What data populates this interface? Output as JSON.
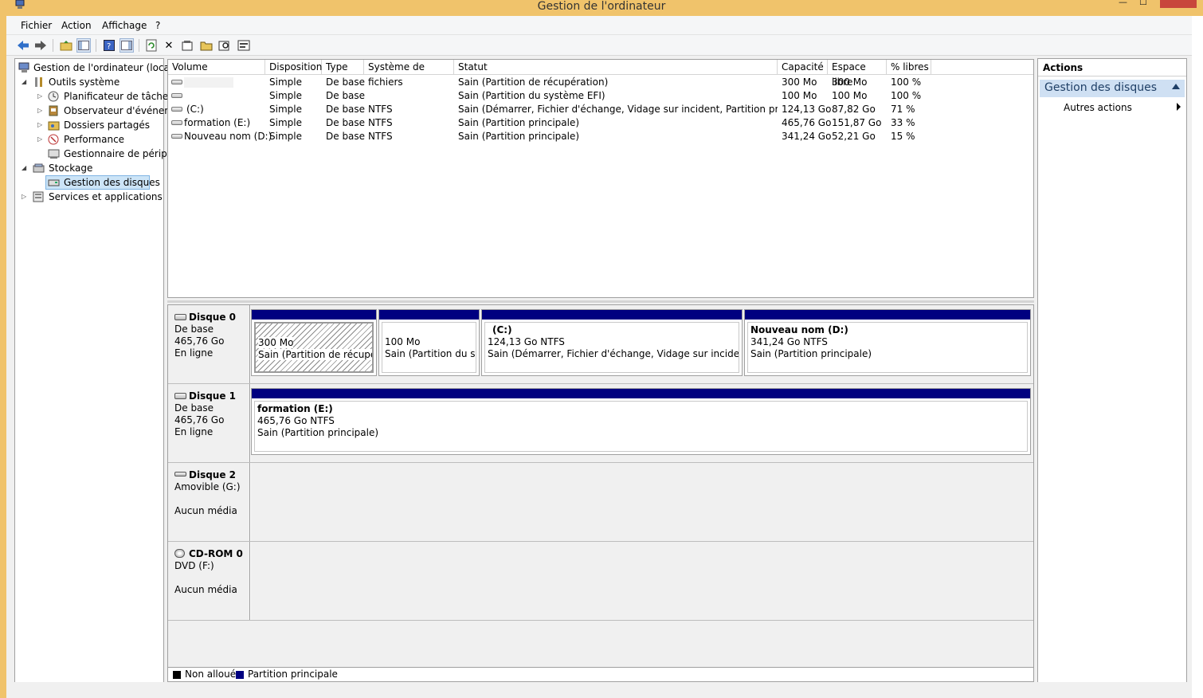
{
  "window": {
    "title": "Gestion de l'ordinateur"
  },
  "menu": [
    "Fichier",
    "Action",
    "Affichage",
    "?"
  ],
  "tree": {
    "root": "Gestion de l'ordinateur (local)",
    "outils": "Outils système",
    "planif": "Planificateur de tâches",
    "observ": "Observateur d'événeme",
    "dossiers": "Dossiers partagés",
    "perf": "Performance",
    "gestperiph": "Gestionnaire de périphé",
    "stockage": "Stockage",
    "gestdisques": "Gestion des disques",
    "services": "Services et applications"
  },
  "volumes": {
    "columns": [
      "Volume",
      "Disposition",
      "Type",
      "Système de fichiers",
      "Statut",
      "Capacité",
      "Espace libre",
      "% libres"
    ],
    "rows": [
      {
        "volume": "",
        "disposition": "Simple",
        "type": "De base",
        "fs": "",
        "statut": "Sain (Partition de récupération)",
        "capacite": "300 Mo",
        "libre": "300 Mo",
        "pct": "100 %"
      },
      {
        "volume": "",
        "disposition": "Simple",
        "type": "De base",
        "fs": "",
        "statut": "Sain (Partition du système EFI)",
        "capacite": "100 Mo",
        "libre": "100 Mo",
        "pct": "100 %"
      },
      {
        "volume": "(C:)",
        "disposition": "Simple",
        "type": "De base",
        "fs": "NTFS",
        "statut": "Sain (Démarrer, Fichier d'échange, Vidage sur incident, Partition principale)",
        "capacite": "124,13 Go",
        "libre": "87,82 Go",
        "pct": "71 %"
      },
      {
        "volume": "formation (E:)",
        "disposition": "Simple",
        "type": "De base",
        "fs": "NTFS",
        "statut": "Sain (Partition principale)",
        "capacite": "465,76 Go",
        "libre": "151,87 Go",
        "pct": "33 %"
      },
      {
        "volume": "Nouveau nom (D:)",
        "disposition": "Simple",
        "type": "De base",
        "fs": "NTFS",
        "statut": "Sain (Partition principale)",
        "capacite": "341,24 Go",
        "libre": "52,21 Go",
        "pct": "15 %"
      }
    ]
  },
  "disks": {
    "d0": {
      "name": "Disque 0",
      "type": "De base",
      "size": "465,76 Go",
      "status": "En ligne",
      "p0": {
        "size": "300 Mo",
        "status": "Sain (Partition de récupérat"
      },
      "p1": {
        "size": "100 Mo",
        "status": "Sain (Partition du syst"
      },
      "p2": {
        "label": "(C:)",
        "size": "124,13 Go NTFS",
        "status": "Sain (Démarrer, Fichier d'échange, Vidage sur incident, Parti"
      },
      "p3": {
        "label": "Nouveau nom  (D:)",
        "size": "341,24 Go NTFS",
        "status": "Sain (Partition principale)"
      }
    },
    "d1": {
      "name": "Disque 1",
      "type": "De base",
      "size": "465,76 Go",
      "status": "En ligne",
      "p0": {
        "label": "formation  (E:)",
        "size": "465,76 Go NTFS",
        "status": "Sain (Partition principale)"
      }
    },
    "d2": {
      "name": "Disque 2",
      "type": "Amovible (G:)",
      "status": "Aucun média"
    },
    "d3": {
      "name": "CD-ROM 0",
      "type": "DVD (F:)",
      "status": "Aucun média"
    }
  },
  "legend": {
    "unallocated": "Non alloué",
    "primary": "Partition principale"
  },
  "actions": {
    "title": "Actions",
    "section": "Gestion des disques",
    "item": "Autres actions"
  },
  "colors": {
    "primary_partition": "#000080",
    "unallocated": "#000000",
    "titlebar": "#f0c36b",
    "action_section": "#cfe0f3"
  }
}
